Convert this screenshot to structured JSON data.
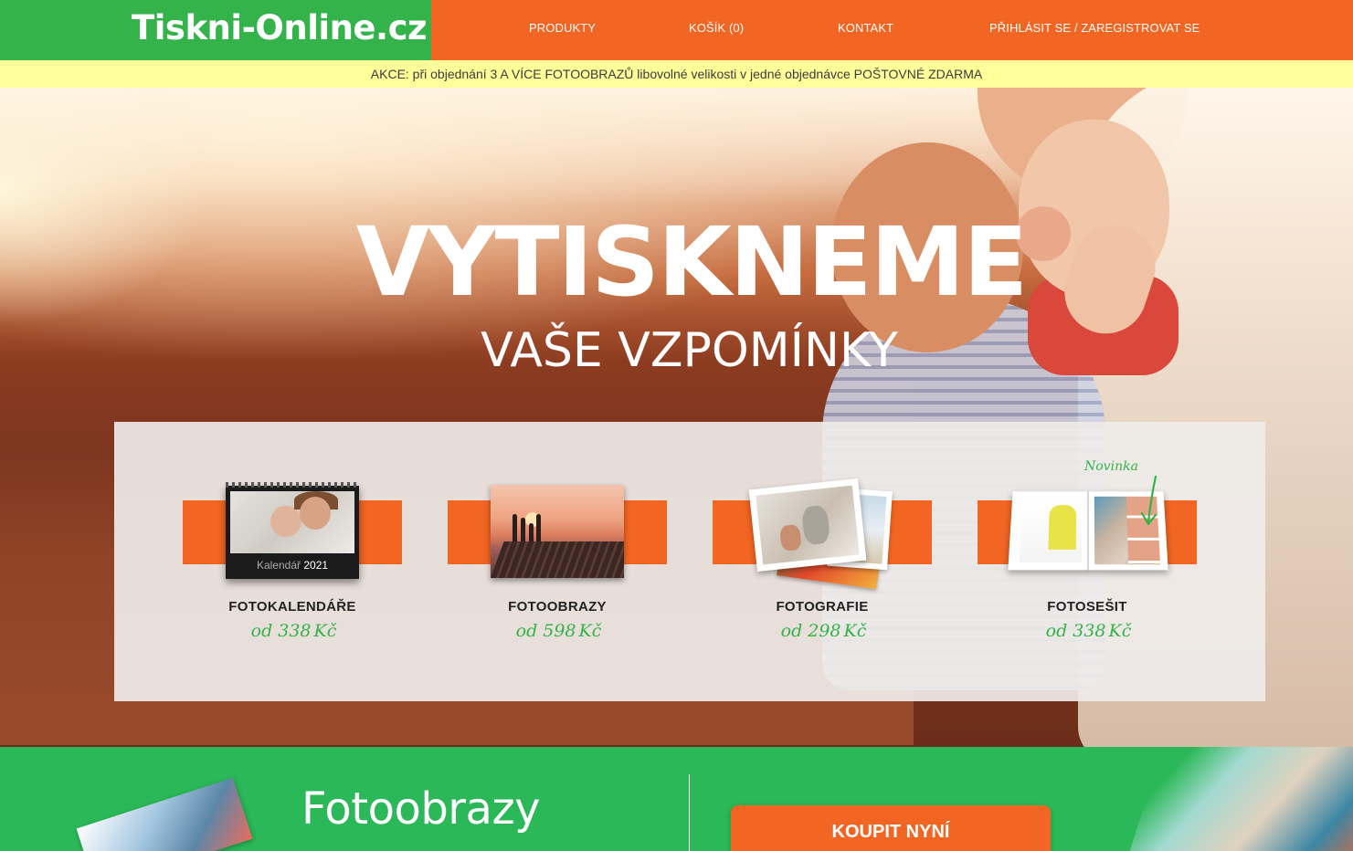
{
  "header": {
    "logo": "Tiskni-Online.cz",
    "nav": [
      {
        "label": "PRODUKTY"
      },
      {
        "label": "KOŠÍK (0)"
      },
      {
        "label": "KONTAKT"
      },
      {
        "label": "PŘIHLÁSIT SE / ZAREGISTROVAT SE"
      }
    ]
  },
  "promo": {
    "text": "AKCE: při objednání 3 A VÍCE FOTOOBRAZŮ libovolné velikosti v jedné objednávce POŠTOVNÉ ZDARMA"
  },
  "hero": {
    "title": "VYTISKNEME",
    "subtitle": "VAŠE VZPOMÍNKY"
  },
  "products": [
    {
      "name": "FOTOKALENDÁŘE",
      "price_prefix": "od",
      "price": "338",
      "currency": "Kč",
      "image_label_1": "Kalendář",
      "image_label_2": "2021"
    },
    {
      "name": "FOTOOBRAZY",
      "price_prefix": "od",
      "price": "598",
      "currency": "Kč"
    },
    {
      "name": "FOTOGRAFIE",
      "price_prefix": "od",
      "price": "298",
      "currency": "Kč"
    },
    {
      "name": "FOTOSEŠIT",
      "price_prefix": "od",
      "price": "338",
      "currency": "Kč",
      "badge": "Novinka"
    }
  ],
  "bottom": {
    "heading": "Fotoobrazy",
    "buy_button": "KOUPIT NYNÍ"
  },
  "colors": {
    "brand_green": "#33b34a",
    "brand_orange": "#f26522",
    "promo_yellow": "#ffff99"
  }
}
